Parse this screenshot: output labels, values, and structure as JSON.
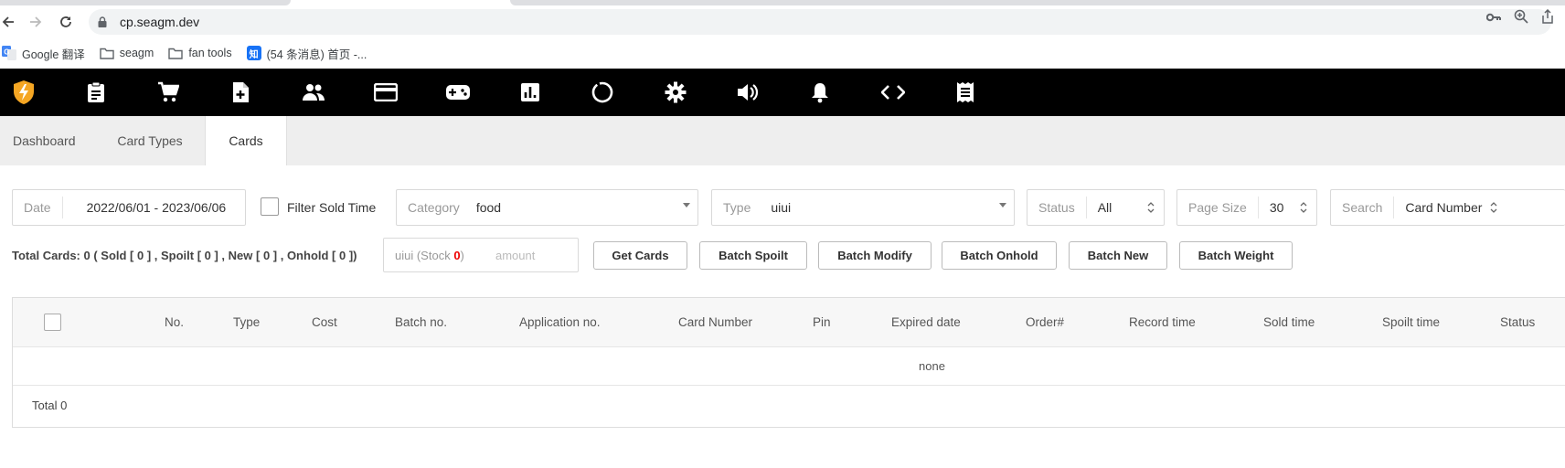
{
  "browser": {
    "url": "cp.seagm.dev",
    "bookmarks": [
      {
        "label": "Google 翻译",
        "icon": "google-translate-icon"
      },
      {
        "label": "seagm",
        "icon": "folder-icon"
      },
      {
        "label": "fan tools",
        "icon": "folder-icon"
      },
      {
        "label": "(54 条消息) 首页 -...",
        "icon": "zhihu-icon",
        "icon_text": "知"
      }
    ]
  },
  "toolbar": {
    "icons": [
      "app-logo-icon",
      "clipboard-icon",
      "cart-icon",
      "add-file-icon",
      "users-icon",
      "credit-card-icon",
      "gamepad-icon",
      "bar-chart-icon",
      "refresh-circle-icon",
      "settings-gear-icon",
      "volume-icon",
      "bell-icon",
      "code-icon",
      "receipt-icon"
    ],
    "accent": "#f5a623"
  },
  "tabs": [
    {
      "label": "Dashboard",
      "active": false
    },
    {
      "label": "Card Types",
      "active": false
    },
    {
      "label": "Cards",
      "active": true
    }
  ],
  "filters": {
    "date_label": "Date",
    "date_value": "2022/06/01 - 2023/06/06",
    "filter_sold_time_label": "Filter Sold Time",
    "category_label": "Category",
    "category_value": "food",
    "type_label": "Type",
    "type_value": "uiui",
    "status_label": "Status",
    "status_value": "All",
    "page_size_label": "Page Size",
    "page_size_value": "30",
    "search_label": "Search",
    "search_value": "Card Number"
  },
  "summary": "Total Cards: 0 ( Sold [ 0 ] , Spoilt [ 0 ] , New [ 0 ] , Onhold [ 0 ])",
  "stock": {
    "prefix": "uiui (Stock ",
    "count": "0",
    "suffix": ")",
    "amount_placeholder": "amount"
  },
  "buttons": {
    "get_cards": "Get Cards",
    "batch_spoilt": "Batch Spoilt",
    "batch_modify": "Batch Modify",
    "batch_onhold": "Batch Onhold",
    "batch_new": "Batch New",
    "batch_weight": "Batch Weight"
  },
  "table": {
    "columns": [
      "No.",
      "Type",
      "Cost",
      "Batch no.",
      "Application no.",
      "Card Number",
      "Pin",
      "Expired date",
      "Order#",
      "Record time",
      "Sold time",
      "Spoilt time",
      "Status"
    ],
    "empty_text": "none",
    "total_text": "Total 0"
  }
}
